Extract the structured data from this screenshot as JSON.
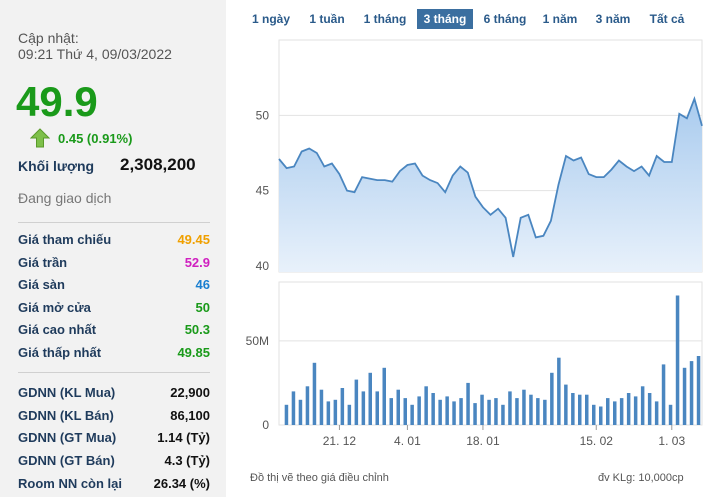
{
  "summary": {
    "update_label": "Cập nhật:",
    "update_time": "09:21 Thứ 4, 09/03/2022",
    "price": "49.9",
    "change": "0.45 (0.91%)",
    "volume_label": "Khối lượng",
    "volume_value": "2,308,200",
    "status": "Đang giao dịch",
    "up_color": "#1a9a1a",
    "arrow_icon": "up-arrow-icon"
  },
  "price_rows": [
    {
      "label": "Giá tham chiếu",
      "value": "49.45",
      "color": "#f0a000"
    },
    {
      "label": "Giá trần",
      "value": "52.9",
      "color": "#d020c0"
    },
    {
      "label": "Giá sàn",
      "value": "46",
      "color": "#1a7fd0"
    },
    {
      "label": "Giá mở cửa",
      "value": "50",
      "color": "#1a9a1a"
    },
    {
      "label": "Giá cao nhất",
      "value": "50.3",
      "color": "#1a9a1a"
    },
    {
      "label": "Giá thấp nhất",
      "value": "49.85",
      "color": "#1a9a1a"
    }
  ],
  "foreign_rows": [
    {
      "label": "GDNN (KL Mua)",
      "value": "22,900"
    },
    {
      "label": "GDNN (KL Bán)",
      "value": "86,100"
    },
    {
      "label": "GDNN (GT Mua)",
      "value": "1.14 (Tỷ)"
    },
    {
      "label": "GDNN (GT Bán)",
      "value": "4.3 (Tỷ)"
    },
    {
      "label": "Room NN còn lại",
      "value": "26.34 (%)"
    }
  ],
  "tabs": [
    {
      "label": "1 ngày",
      "active": false
    },
    {
      "label": "1 tuần",
      "active": false
    },
    {
      "label": "1 tháng",
      "active": false
    },
    {
      "label": "3 tháng",
      "active": true
    },
    {
      "label": "6 tháng",
      "active": false
    },
    {
      "label": "1 năm",
      "active": false
    },
    {
      "label": "3 năm",
      "active": false
    },
    {
      "label": "Tất cả",
      "active": false
    }
  ],
  "chart_data": {
    "type": "area",
    "line_color": "#4a86c0",
    "bar_color": "#4a86c0",
    "price_yticks": [
      40,
      45,
      50
    ],
    "price_ylim": [
      39.6,
      55
    ],
    "volume_yticks": [
      "0",
      "50M"
    ],
    "volume_ylim": [
      0,
      85
    ],
    "x_tick_labels": [
      {
        "label": "21. 12",
        "index": 8
      },
      {
        "label": "4. 01",
        "index": 17
      },
      {
        "label": "18. 01",
        "index": 27
      },
      {
        "label": "15. 02",
        "index": 42
      },
      {
        "label": "1. 03",
        "index": 52
      }
    ],
    "prices": [
      47.1,
      46.5,
      46.6,
      47.6,
      47.8,
      47.5,
      46.6,
      46.8,
      46.1,
      45.0,
      44.9,
      45.9,
      45.8,
      45.7,
      45.7,
      45.6,
      46.3,
      46.7,
      46.8,
      46.0,
      45.7,
      45.5,
      44.9,
      46.0,
      46.6,
      46.2,
      44.6,
      43.9,
      43.4,
      43.8,
      43.2,
      40.6,
      43.2,
      43.4,
      41.9,
      42.0,
      43.0,
      45.4,
      47.3,
      47.0,
      47.2,
      46.1,
      45.9,
      45.9,
      46.4,
      47.0,
      46.6,
      46.3,
      46.6,
      46.0,
      47.3,
      46.9,
      46.9,
      50.1,
      49.8,
      51.1,
      49.3
    ],
    "volumes": [
      12,
      20,
      15,
      23,
      37,
      21,
      14,
      15,
      22,
      12,
      27,
      20,
      31,
      20,
      34,
      16,
      21,
      16,
      12,
      17,
      23,
      19,
      15,
      17,
      14,
      16,
      25,
      13,
      18,
      15,
      16,
      12,
      20,
      16,
      21,
      18,
      16,
      15,
      31,
      40,
      24,
      19,
      18,
      18,
      12,
      11,
      16,
      14,
      16,
      19,
      17,
      23,
      19,
      14,
      36,
      12,
      77,
      34,
      38,
      41
    ]
  },
  "footnote": "Đồ thị vẽ theo giá điều chỉnh",
  "unit_note": "đv KLg: 10,000cp"
}
